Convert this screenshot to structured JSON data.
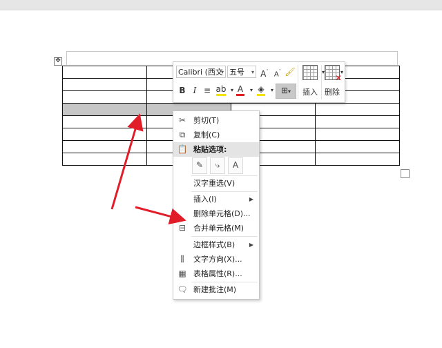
{
  "mini_toolbar": {
    "font_name": "Calibri (西文",
    "font_size": "五号",
    "insert_label": "插入",
    "delete_label": "删除"
  },
  "context_menu": {
    "cut": "剪切(T)",
    "copy": "复制(C)",
    "paste_options": "粘贴选项:",
    "reconvert": "汉字重选(V)",
    "insert": "插入(I)",
    "delete_cells": "删除单元格(D)...",
    "merge_cells": "合并单元格(M)",
    "border_style": "边框样式(B)",
    "text_direction": "文字方向(X)...",
    "table_properties": "表格属性(R)...",
    "new_comment": "新建批注(M)"
  },
  "colors": {
    "annotation_arrow": "#e11d2a",
    "selected_cell": "#c6c6c6",
    "highlight_yellow": "#f5e100",
    "font_color_red": "#e02020"
  }
}
